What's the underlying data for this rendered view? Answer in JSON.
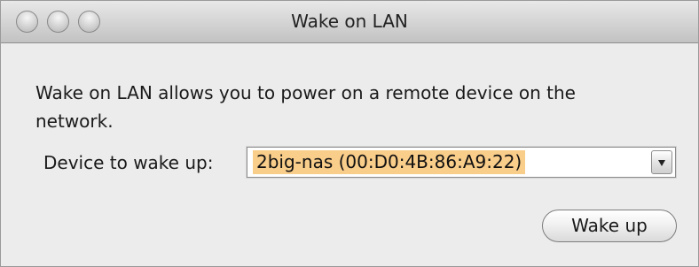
{
  "window": {
    "title": "Wake on LAN"
  },
  "main": {
    "description": "Wake on LAN allows you to power on a remote device on the network.",
    "device_label": "Device to wake up:",
    "device_selected": "2big-nas (00:D0:4B:86:A9:22)",
    "wake_button_label": "Wake up"
  },
  "colors": {
    "selection_highlight": "#f9cd8a",
    "window_background": "#ececec"
  },
  "icons": {
    "close": "close-icon",
    "minimize": "minimize-icon",
    "zoom": "zoom-icon",
    "dropdown": "chevron-down-icon"
  }
}
